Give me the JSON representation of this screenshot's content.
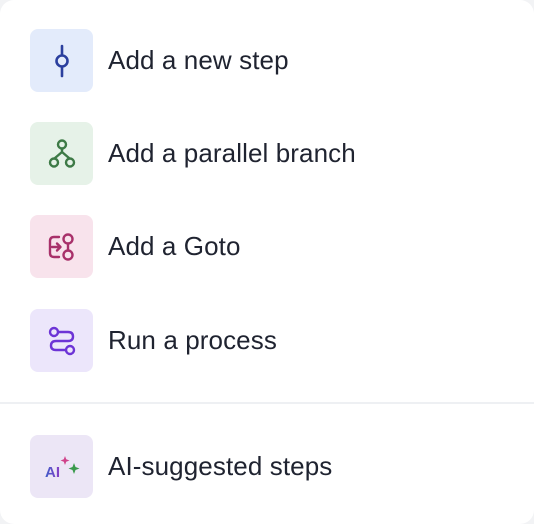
{
  "menu": {
    "items": [
      {
        "label": "Add a new step",
        "icon": "commit-node-icon",
        "tile_color": "#e3ebfb",
        "icon_color": "#2b3f9e"
      },
      {
        "label": "Add a parallel branch",
        "icon": "branch-icon",
        "tile_color": "#e6f2e8",
        "icon_color": "#3d7a46"
      },
      {
        "label": "Add a Goto",
        "icon": "goto-icon",
        "tile_color": "#f8e3ec",
        "icon_color": "#a8316a"
      },
      {
        "label": "Run a process",
        "icon": "process-route-icon",
        "tile_color": "#ece6fb",
        "icon_color": "#6d34d6"
      }
    ],
    "ai_item": {
      "label": "AI-suggested steps",
      "icon": "ai-sparkle-icon",
      "icon_text": "AI",
      "tile_color": "#ece6f6"
    }
  }
}
